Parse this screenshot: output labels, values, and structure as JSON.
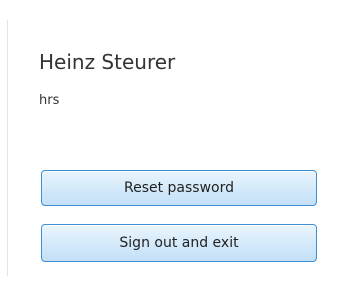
{
  "user": {
    "name": "Heinz Steurer",
    "id": "hrs"
  },
  "actions": {
    "reset_password_label": "Reset password",
    "sign_out_label": "Sign out and exit"
  }
}
